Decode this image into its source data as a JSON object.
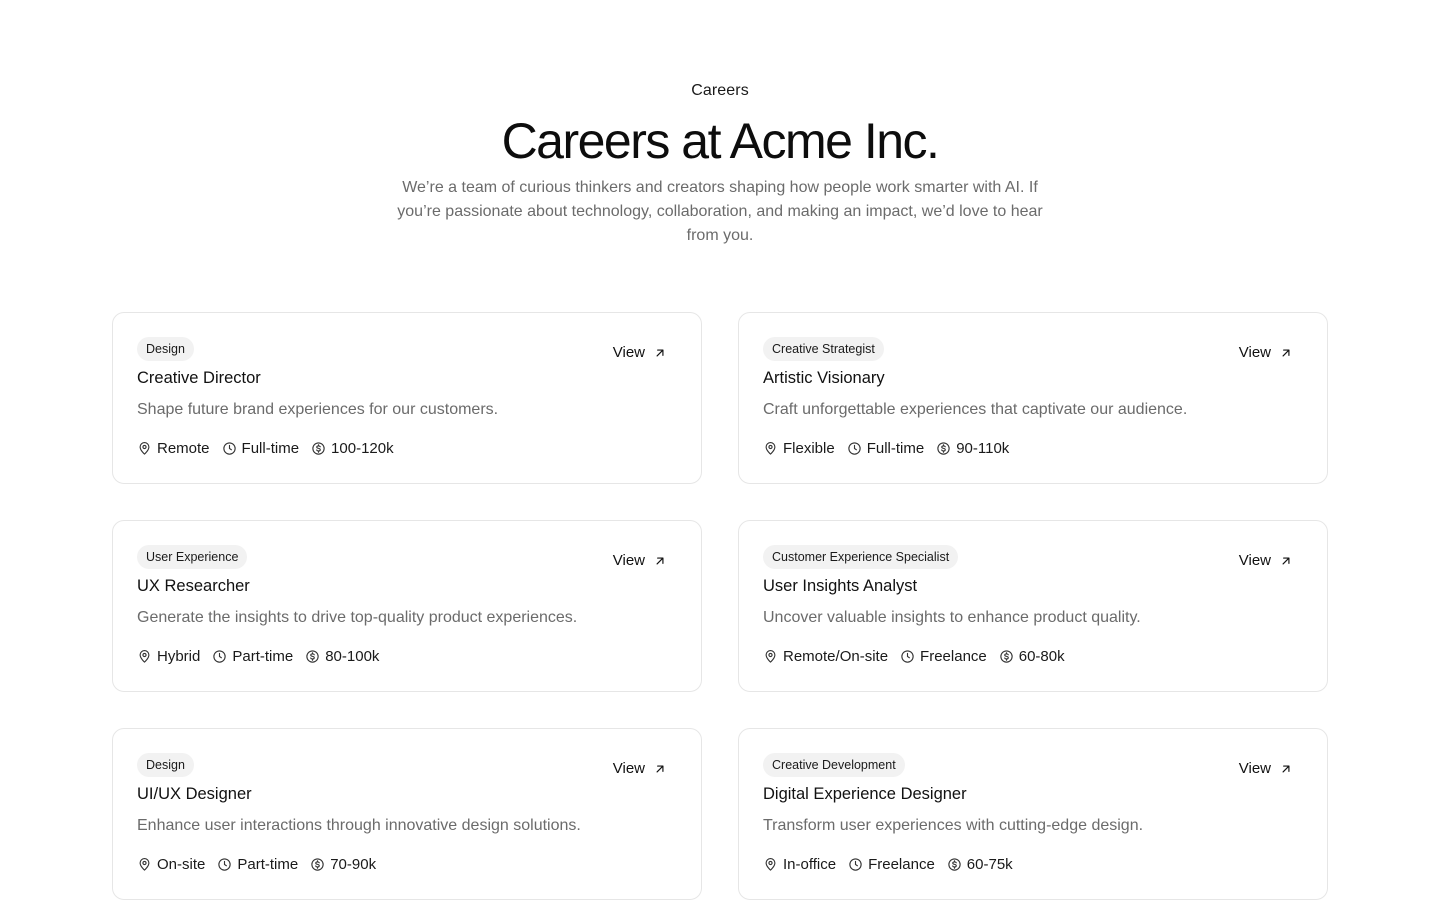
{
  "header": {
    "eyebrow": "Careers",
    "title": "Careers at Acme Inc.",
    "subtitle": "We’re a team of curious thinkers and creators shaping how people work smarter with AI. If you’re passionate about technology, collaboration, and making an impact, we’d love to hear from you."
  },
  "view_label": "View",
  "jobs": [
    {
      "tag": "Design",
      "title": "Creative Director",
      "description": "Shape future brand experiences for our customers.",
      "location": "Remote",
      "type": "Full-time",
      "salary": "100-120k"
    },
    {
      "tag": "Creative Strategist",
      "title": "Artistic Visionary",
      "description": "Craft unforgettable experiences that captivate our audience.",
      "location": "Flexible",
      "type": "Full-time",
      "salary": "90-110k"
    },
    {
      "tag": "User Experience",
      "title": "UX Researcher",
      "description": "Generate the insights to drive top-quality product experiences.",
      "location": "Hybrid",
      "type": "Part-time",
      "salary": "80-100k"
    },
    {
      "tag": "Customer Experience Specialist",
      "title": "User Insights Analyst",
      "description": "Uncover valuable insights to enhance product quality.",
      "location": "Remote/On-site",
      "type": "Freelance",
      "salary": "60-80k"
    },
    {
      "tag": "Design",
      "title": "UI/UX Designer",
      "description": "Enhance user interactions through innovative design solutions.",
      "location": "On-site",
      "type": "Part-time",
      "salary": "70-90k"
    },
    {
      "tag": "Creative Development",
      "title": "Digital Experience Designer",
      "description": "Transform user experiences with cutting-edge design.",
      "location": "In-office",
      "type": "Freelance",
      "salary": "60-75k"
    }
  ]
}
